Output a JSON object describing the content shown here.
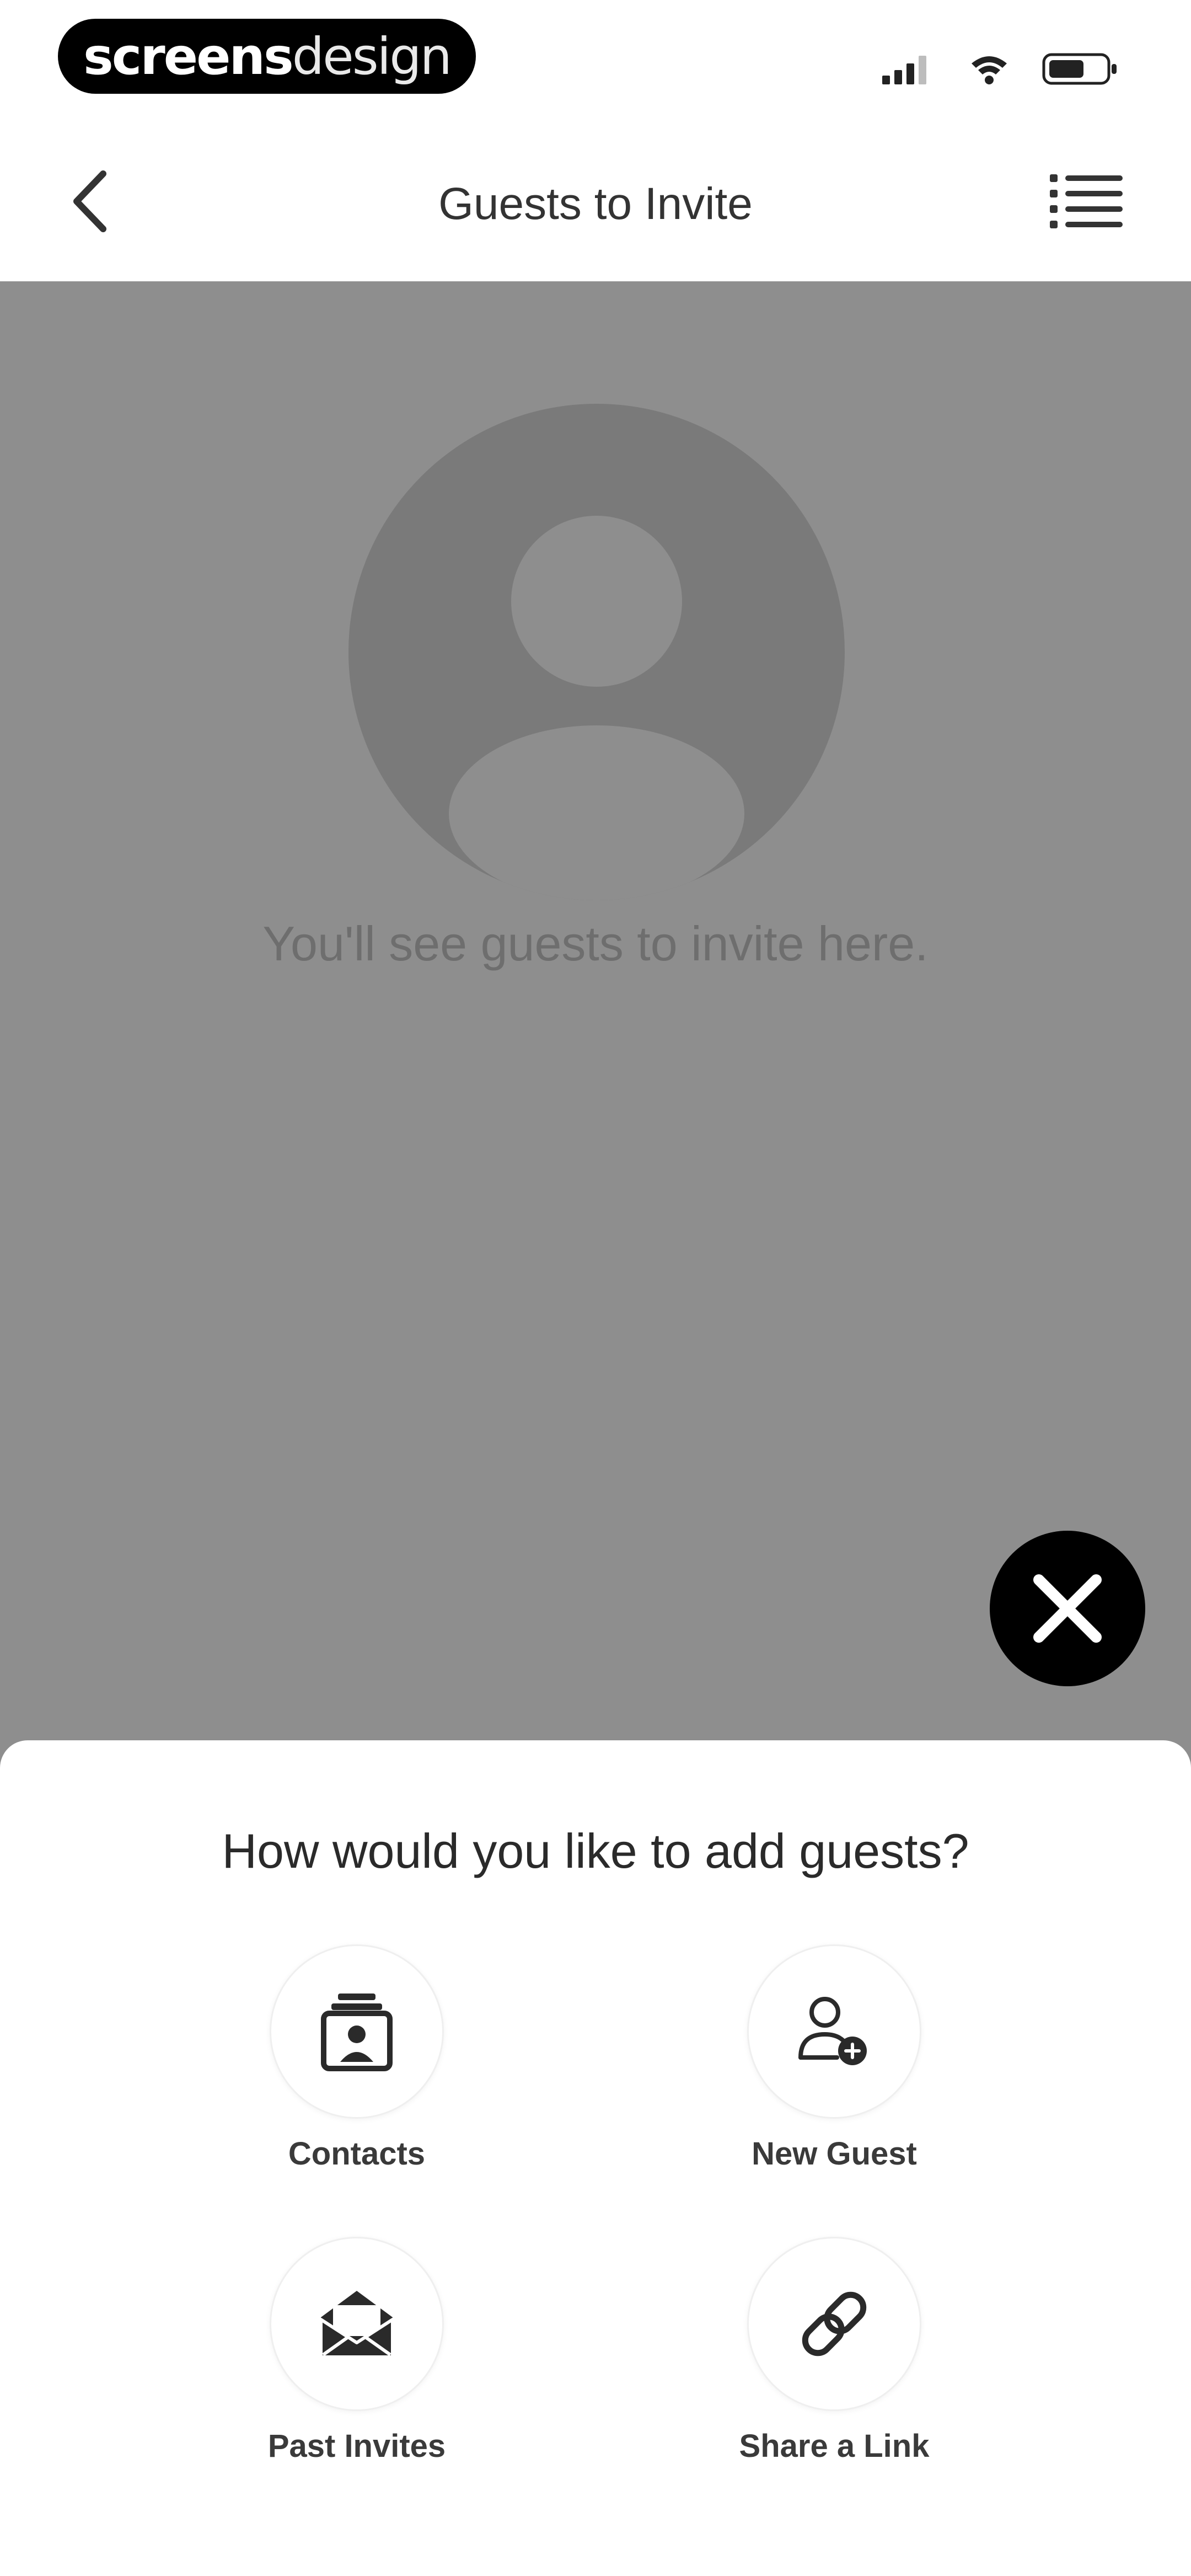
{
  "status_bar": {
    "brand_bold": "screens",
    "brand_light": "design",
    "icons": [
      "cellular-signal-icon",
      "wifi-icon",
      "battery-icon"
    ]
  },
  "nav": {
    "title": "Guests to Invite",
    "back_icon": "chevron-left-icon",
    "list_icon": "list-icon"
  },
  "empty_state": {
    "icon": "user-avatar-icon",
    "message": "You'll see guests to invite here."
  },
  "close_button": {
    "icon": "close-icon"
  },
  "sheet": {
    "title": "How would you like to add guests?",
    "options": [
      {
        "label": "Contacts",
        "icon": "contacts-icon"
      },
      {
        "label": "New Guest",
        "icon": "add-person-icon"
      },
      {
        "label": "Past Invites",
        "icon": "envelope-open-icon"
      },
      {
        "label": "Share a Link",
        "icon": "link-icon"
      }
    ]
  },
  "colors": {
    "overlay": "#8e8e8e",
    "avatar_circle": "#7a7a7a",
    "avatar_figure": "#8e8e8e",
    "fab": "#000000",
    "sheet": "#ffffff"
  }
}
